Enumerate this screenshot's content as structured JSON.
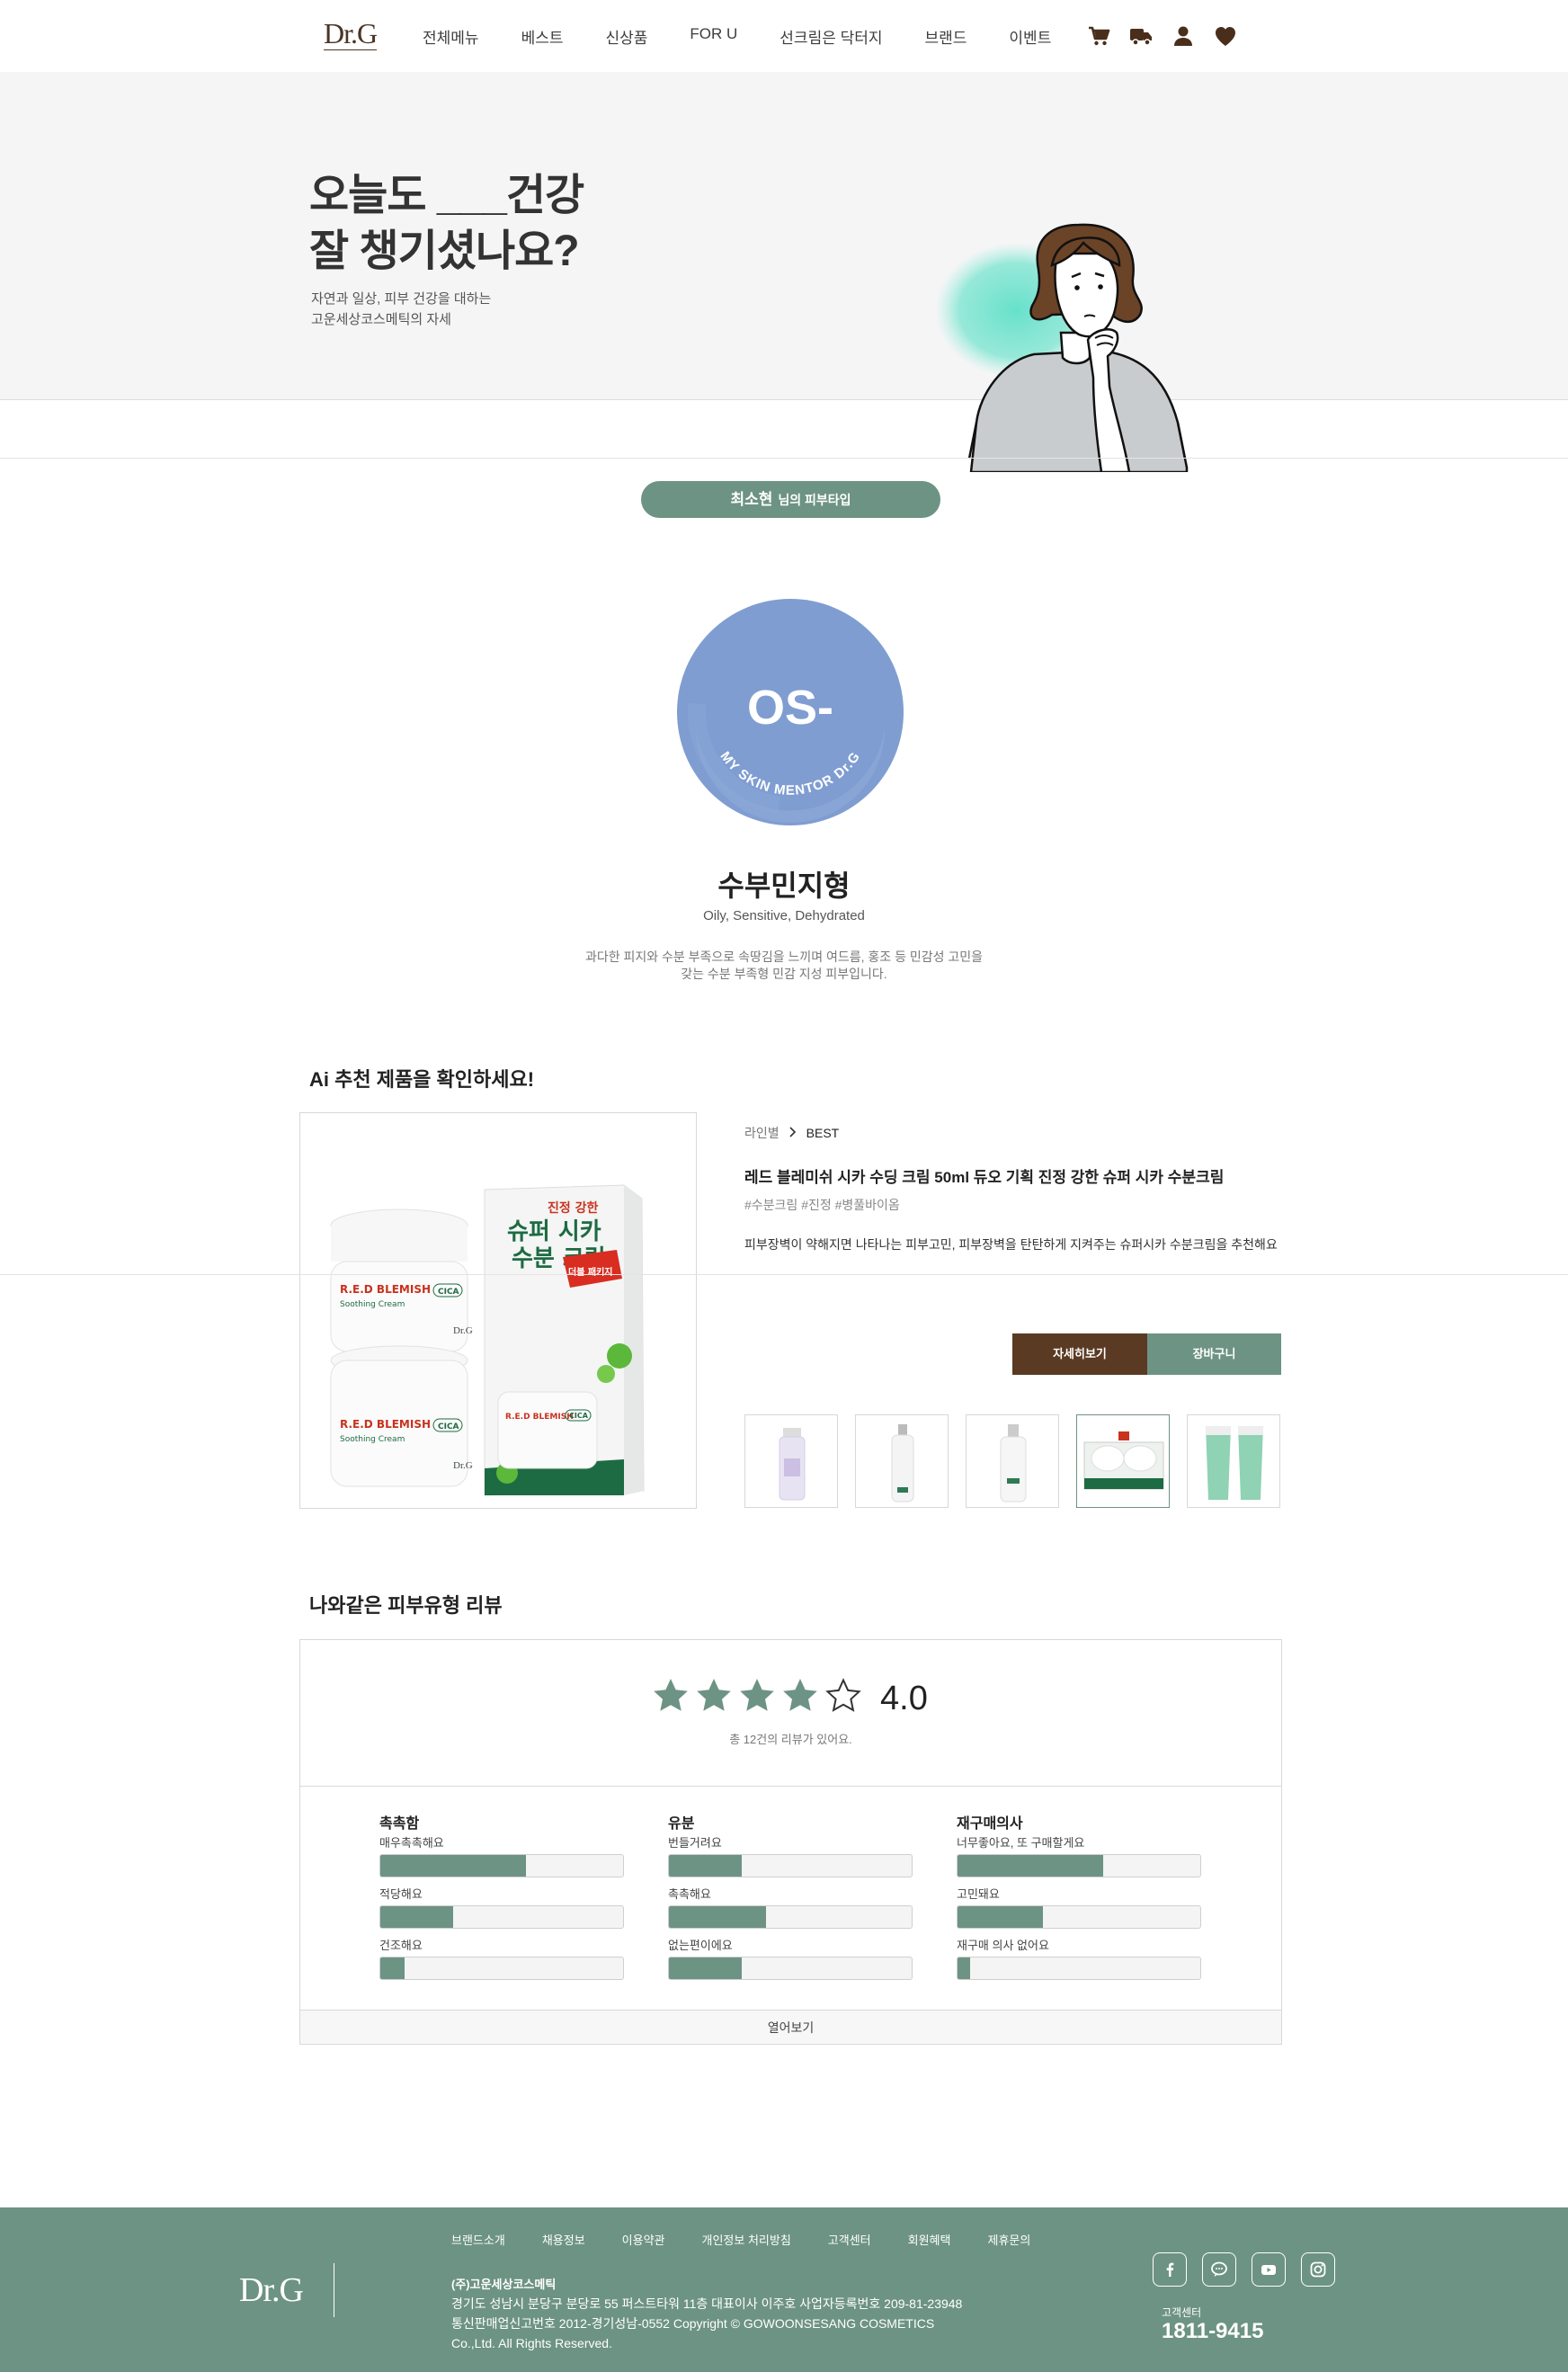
{
  "header": {
    "logo": "Dr.G",
    "nav": [
      "전체메뉴",
      "베스트",
      "신상품",
      "FOR U",
      "선크림은 닥터지",
      "브랜드",
      "이벤트"
    ]
  },
  "hero": {
    "title_line1": "오늘도 ___건강",
    "title_line2": "잘 챙기셨나요?",
    "sub_line1": "자연과 일상, 피부 건강을 대하는",
    "sub_line2": "고운세상코스메틱의 자세"
  },
  "skin": {
    "user_name": "최소현",
    "user_suffix": "님의 피부타입",
    "type_code": "OS-",
    "badge_text": "MY SKIN MENTOR Dr.G",
    "type_name": "수부민지형",
    "type_en": "Oily, Sensitive, Dehydrated",
    "desc_line1": "과다한 피지와 수분 부족으로 속땅김을 느끼며 여드름, 홍조 등 민감성 고민을",
    "desc_line2": "갖는 수분 부족형 민감 지성 피부입니다."
  },
  "recommend": {
    "title": "Ai 추천 제품을 확인하세요!",
    "breadcrumb_line": "라인별",
    "breadcrumb_current": "BEST",
    "product_name": "레드 블레미쉬 시카 수딩 크림 50ml 듀오 기획 진정 강한 슈퍼 시카 수분크림",
    "tags": "#수분크림 #진정 #병풀바이옴",
    "desc": "피부장벽이 약해지면 나타나는 피부고민, 피부장벽을 탄탄하게 지켜주는 슈퍼시카 수분크림을 추천해요",
    "btn_detail": "자세히보기",
    "btn_cart": "장바구니",
    "box_text_1": "진정 강한",
    "box_text_2": "슈퍼 시카",
    "box_text_3": "수분 크림",
    "jar_label": "R.E.D BLEMISH",
    "jar_sub": "Soothing Cream",
    "jar_cica": "CICA",
    "jar_brand": "Dr.G",
    "sticker": "더블 패키지"
  },
  "reviews": {
    "title": "나와같은 피부유형 리뷰",
    "rating": "4.0",
    "rating_value": 4.0,
    "stars_filled": 4,
    "stars_total": 5,
    "count_text": "총 12건의 리뷰가 있어요.",
    "stats": [
      {
        "title": "촉촉함",
        "items": [
          {
            "label": "매우촉촉해요",
            "pct": 60
          },
          {
            "label": "적당해요",
            "pct": 30
          },
          {
            "label": "건조해요",
            "pct": 10
          }
        ]
      },
      {
        "title": "유분",
        "items": [
          {
            "label": "번들거려요",
            "pct": 30
          },
          {
            "label": "촉촉해요",
            "pct": 40
          },
          {
            "label": "없는편이에요",
            "pct": 30
          }
        ]
      },
      {
        "title": "재구매의사",
        "items": [
          {
            "label": "너무좋아요, 또 구매할게요",
            "pct": 60
          },
          {
            "label": "고민돼요",
            "pct": 35
          },
          {
            "label": "재구매 의사 없어요",
            "pct": 5
          }
        ]
      }
    ],
    "more": "열어보기"
  },
  "footer": {
    "logo": "Dr.G",
    "links": [
      "브랜드소개",
      "채용정보",
      "이용약관",
      "개인정보 처리방침",
      "고객센터",
      "회원혜택",
      "제휴문의"
    ],
    "company": "(주)고운세상코스메틱",
    "addr1": "경기도 성남시 분당구 분당로 55 퍼스트타워 11층 대표이사 이주호 사업자등록번호 209-81-23948",
    "addr2": "통신판매업신고번호 2012-경기성남-0552 Copyright © GOWOONSESANG COSMETICS",
    "addr3": "Co.,Ltd. All Rights Reserved.",
    "cs_label": "고객센터",
    "cs_phone": "1811-9415"
  },
  "colors": {
    "brand_brown": "#5a3a22",
    "brand_green": "#6d9385",
    "type_circle": "#7f9dd1"
  },
  "icons": [
    "cart-icon",
    "delivery-truck-icon",
    "user-icon",
    "heart-icon",
    "chevron-right-icon",
    "star-icon",
    "facebook-icon",
    "kakao-talk-icon",
    "youtube-icon",
    "instagram-icon"
  ]
}
